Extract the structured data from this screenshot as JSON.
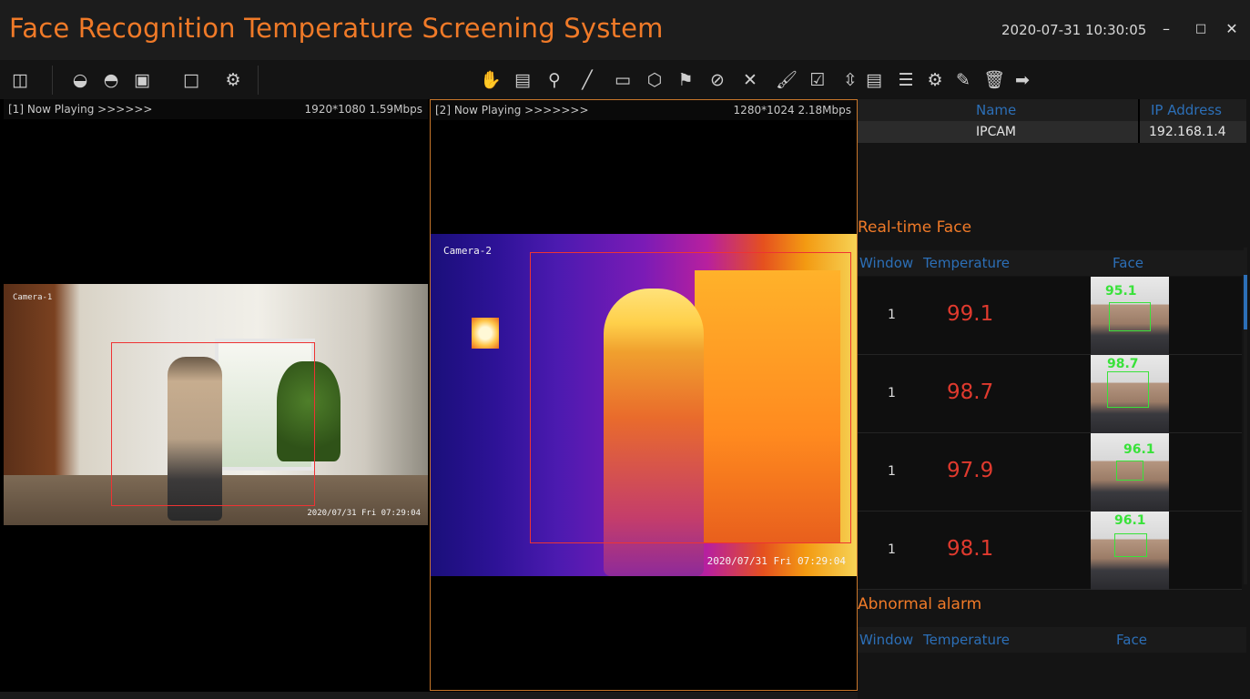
{
  "window": {
    "title": "Face Recognition Temperature Screening System",
    "clock": "2020-07-31 10:30:05",
    "minimize": "–",
    "maximize": "□",
    "close": "✕"
  },
  "toolbar_left": [
    {
      "name": "layout-icon",
      "glyph": "◫"
    },
    {
      "name": "camera-icon",
      "glyph": "◒"
    },
    {
      "name": "camera-off-icon",
      "glyph": "◓"
    },
    {
      "name": "snapshot-icon",
      "glyph": "▣"
    },
    {
      "name": "window-icon",
      "glyph": "□"
    },
    {
      "name": "settings-icon",
      "glyph": "⚙"
    }
  ],
  "toolbar_draw": [
    {
      "name": "hand-icon",
      "glyph": "✋"
    },
    {
      "name": "screen-icon",
      "glyph": "▤"
    },
    {
      "name": "pin-icon",
      "glyph": "⚲"
    },
    {
      "name": "line-icon",
      "glyph": "╱"
    },
    {
      "name": "rect-icon",
      "glyph": "▭"
    },
    {
      "name": "hexagon-icon",
      "glyph": "⬡"
    },
    {
      "name": "flag-icon",
      "glyph": "⚑"
    },
    {
      "name": "no-entry-icon",
      "glyph": "⊘"
    },
    {
      "name": "clear-icon",
      "glyph": "✕"
    },
    {
      "name": "paint-icon",
      "glyph": "🖌"
    },
    {
      "name": "checklist-icon",
      "glyph": "☑"
    },
    {
      "name": "expand-icon",
      "glyph": "⇳"
    }
  ],
  "toolbar_right": [
    {
      "name": "list-detail-icon",
      "glyph": "▤"
    },
    {
      "name": "menu-icon",
      "glyph": "☰"
    },
    {
      "name": "gear-icon",
      "glyph": "⚙"
    },
    {
      "name": "edit-icon",
      "glyph": "✎"
    },
    {
      "name": "delete-icon",
      "glyph": "🗑"
    },
    {
      "name": "arrow-right-icon",
      "glyph": "➡"
    }
  ],
  "panes": [
    {
      "status": "[1] Now Playing >>>>>>",
      "resolution": "1920*1080 1.59Mbps",
      "camera_label": "Camera-1",
      "timestamp": "2020/07/31 Fri 07:29:04"
    },
    {
      "status": "[2] Now Playing >>>>>>>",
      "resolution": "1280*1024 2.18Mbps",
      "camera_label": "Camera-2",
      "timestamp": "2020/07/31 Fri 07:29:04"
    }
  ],
  "devices": {
    "headers": {
      "name": "Name",
      "ip": "IP Address"
    },
    "rows": [
      {
        "name": "IPCAM",
        "ip": "192.168.1.4"
      }
    ]
  },
  "realtime": {
    "title": "Real-time Face",
    "headers": {
      "window": "Window",
      "temperature": "Temperature",
      "face": "Face"
    },
    "rows": [
      {
        "window": "1",
        "temperature": "99.1",
        "face_temp": "95.1"
      },
      {
        "window": "1",
        "temperature": "98.7",
        "face_temp": "98.7"
      },
      {
        "window": "1",
        "temperature": "97.9",
        "face_temp": "96.1"
      },
      {
        "window": "1",
        "temperature": "98.1",
        "face_temp": "96.1"
      }
    ]
  },
  "alarm": {
    "title": "Abnormal alarm",
    "headers": {
      "window": "Window",
      "temperature": "Temperature",
      "face": "Face"
    }
  },
  "colors": {
    "accent": "#f07a28",
    "header_blue": "#2c6fb7",
    "temp_red": "#e03a2e",
    "box_green": "#39e23a"
  }
}
